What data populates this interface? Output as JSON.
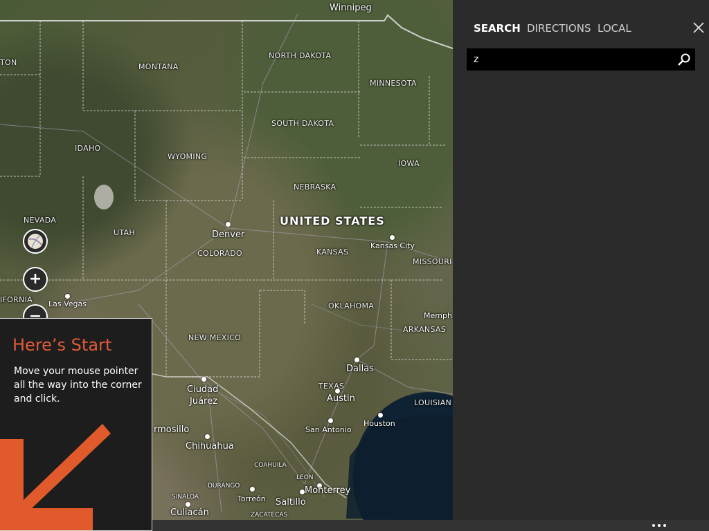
{
  "map": {
    "labels": {
      "winnipeg": "Winnipeg",
      "north_dakota": "NORTH DAKOTA",
      "montana": "MONTANA",
      "minnesota": "MINNESOTA",
      "ton": "TON",
      "south_dakota": "SOUTH DAKOTA",
      "idaho": "IDAHO",
      "wyoming": "WYOMING",
      "iowa": "IOWA",
      "nebraska": "NEBRASKA",
      "nevada": "NEVADA",
      "united_states": "UNITED STATES",
      "utah": "UTAH",
      "denver": "Denver",
      "colorado": "COLORADO",
      "kansas_city": "Kansas City",
      "kansas": "KANSAS",
      "missouri": "MISSOURI",
      "ifornia": "IFORNIA",
      "las_vegas": "Las Vegas",
      "oklahoma": "OKLAHOMA",
      "memph": "Memph",
      "arkansas": "ARKANSAS",
      "new_mexico": "NEW MEXICO",
      "dallas": "Dallas",
      "ciudad_juarez_1": "Ciudad",
      "ciudad_juarez_2": "Juárez",
      "texas": "TEXAS",
      "austin": "Austin",
      "louisian": "LOUISIAN",
      "houston": "Houston",
      "rmosillo": "rmosillo",
      "san_antonio": "San Antonio",
      "chihuahua": "Chihuahua",
      "coahuila": "COAHUILA",
      "leon": "LEON",
      "durango": "DURANGO",
      "torreon": "Torreón",
      "monterrey": "Monterrey",
      "saltillo": "Saltillo",
      "sinaloa": "SINALOA",
      "culiacan": "Culiacán",
      "zacatecas": "ZACATECAS"
    },
    "controls": {
      "zoom_in_symbol": "+",
      "zoom_out_symbol": "−",
      "map_style_icon": "map-style-icon"
    }
  },
  "start_tip": {
    "title": "Here’s Start",
    "body": "Move your mouse pointer all the way into the corner and click.",
    "arrow_color": "#e05a2b",
    "title_color": "#e05a3a"
  },
  "pane": {
    "tabs": [
      {
        "label": "SEARCH",
        "active": true
      },
      {
        "label": "DIRECTIONS",
        "active": false
      },
      {
        "label": "LOCAL",
        "active": false
      }
    ],
    "close_icon": "close-icon",
    "search": {
      "value": "z",
      "icon": "search-icon"
    }
  },
  "appbar": {
    "more_icon": "more-ellipsis-icon"
  }
}
